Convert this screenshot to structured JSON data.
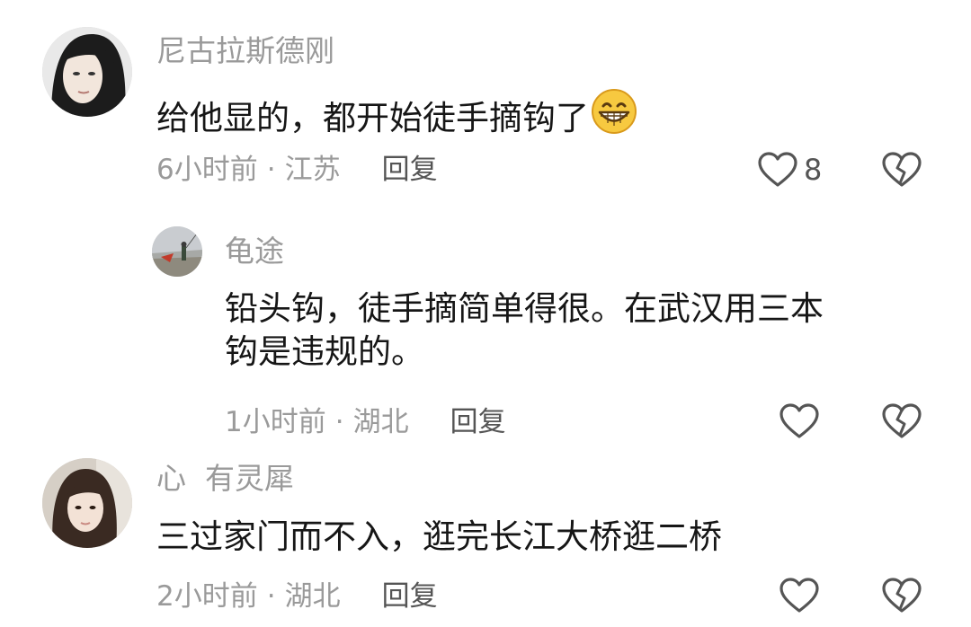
{
  "comments": [
    {
      "username": "尼古拉斯德刚",
      "text": "给他显的，都开始徒手摘钩了",
      "emoji": "grinning-face-emoji",
      "time": "6小时前",
      "separator": "·",
      "location": "江苏",
      "reply_label": "回复",
      "like_count": "8",
      "replies": [
        {
          "username": "龟途",
          "text_lines": [
            "铅头钩，徒手摘简单得很。在武汉用三本",
            "钩是违规的。"
          ],
          "time": "1小时前",
          "separator": "·",
          "location": "湖北",
          "reply_label": "回复"
        }
      ]
    },
    {
      "username": "心  有灵犀",
      "text": "三过家门而不入，逛完长江大桥逛二桥",
      "time": "2小时前",
      "separator": "·",
      "location": "湖北",
      "reply_label": "回复"
    }
  ],
  "icons": {
    "like": "heart-outline-icon",
    "dislike": "broken-heart-icon"
  },
  "colors": {
    "text": "#161616",
    "secondary": "#9a9a9a",
    "action": "#555555",
    "emoji": "#f7c940"
  }
}
